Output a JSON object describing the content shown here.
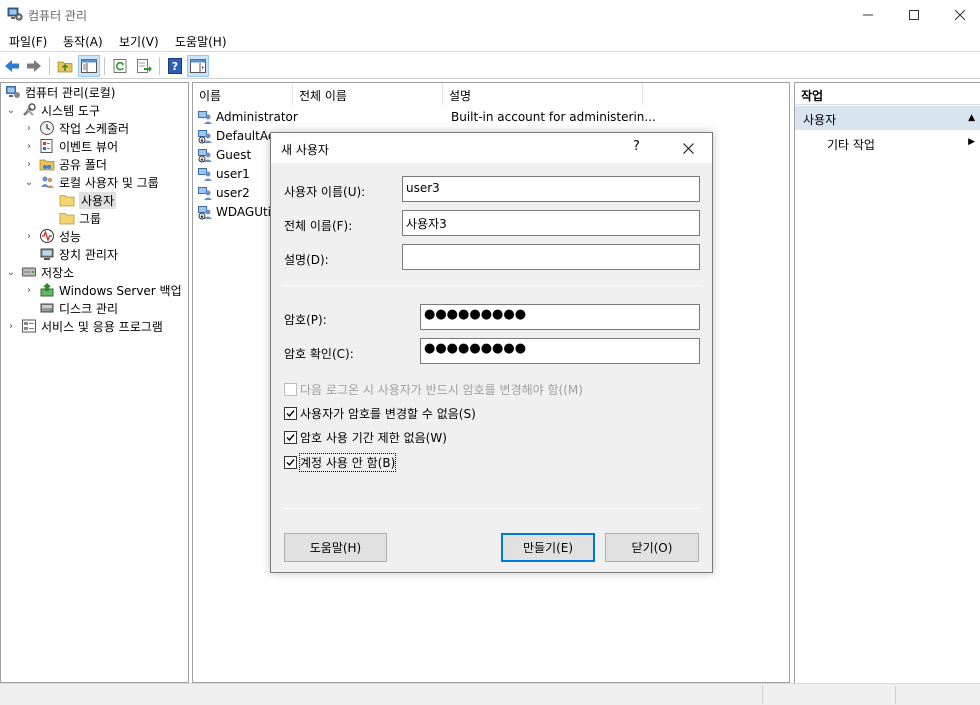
{
  "window": {
    "title": "컴퓨터 관리"
  },
  "menu": [
    "파일(F)",
    "동작(A)",
    "보기(V)",
    "도움말(H)"
  ],
  "tree": {
    "root": "컴퓨터 관리(로컬)",
    "system_tools": "시스템 도구",
    "task_scheduler": "작업 스케줄러",
    "event_viewer": "이벤트 뷰어",
    "shared_folders": "공유 폴더",
    "local_users_groups": "로컬 사용자 및 그룹",
    "users": "사용자",
    "groups": "그룹",
    "performance": "성능",
    "device_manager": "장치 관리자",
    "storage": "저장소",
    "windows_backup": "Windows Server 백업",
    "disk_management": "디스크 관리",
    "services_apps": "서비스 및 응용 프로그램"
  },
  "list": {
    "columns": [
      "이름",
      "전체 이름",
      "설명"
    ],
    "rows": [
      {
        "name": "Administrator",
        "description": "Built-in account for administerin..."
      },
      {
        "name": "DefaultAc"
      },
      {
        "name": "Guest"
      },
      {
        "name": "user1"
      },
      {
        "name": "user2"
      },
      {
        "name": "WDAGUtil"
      }
    ]
  },
  "actions": {
    "header": "작업",
    "section": "사용자",
    "more": "기타 작업"
  },
  "dialog": {
    "title": "새 사용자",
    "help_glyph": "?",
    "username_label": "사용자 이름(U):",
    "username_value": "user3",
    "fullname_label": "전체 이름(F):",
    "fullname_value": "사용자3",
    "description_label": "설명(D):",
    "description_value": "",
    "password_label": "암호(P):",
    "password_value": "●●●●●●●●●",
    "confirm_label": "암호 확인(C):",
    "confirm_value": "●●●●●●●●●",
    "checks": [
      {
        "label": "다음 로그온 시 사용자가 반드시 암호를 변경해야 함((M)",
        "checked": false,
        "disabled": true
      },
      {
        "label": "사용자가 암호를 변경할 수 없음(S)",
        "checked": true,
        "disabled": false
      },
      {
        "label": "암호 사용 기간 제한 없음(W)",
        "checked": true,
        "disabled": false
      },
      {
        "label": "계정 사용 안 함(B)",
        "checked": true,
        "disabled": false
      }
    ],
    "help_button": "도움말(H)",
    "create_button": "만들기(E)",
    "close_button": "닫기(O)"
  },
  "colors": {
    "accent": "#0078d7",
    "selection": "#d9e4f1",
    "chrome": "#f0f0f0"
  }
}
